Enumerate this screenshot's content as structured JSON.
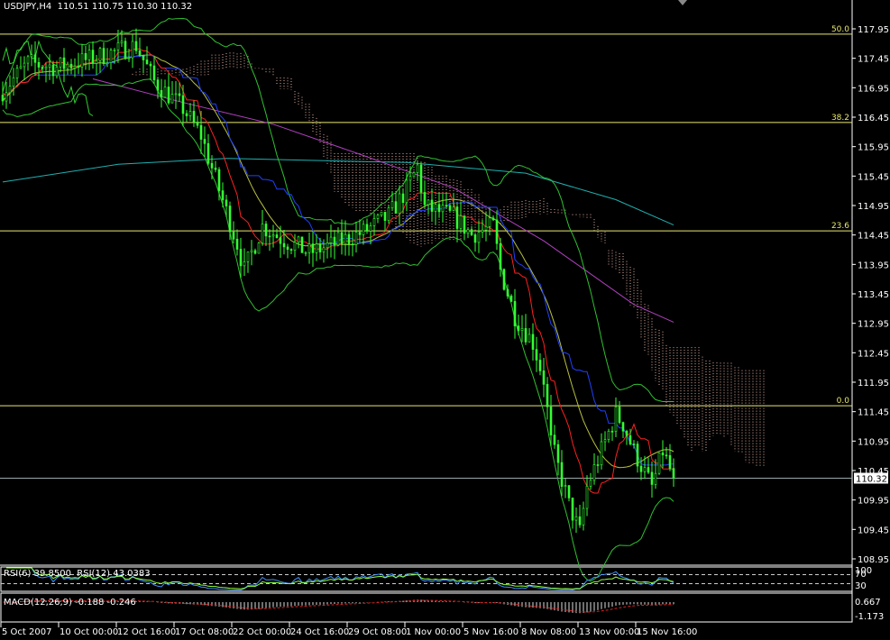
{
  "title": {
    "symbol": "USDJPY,H4",
    "ohlc": "110.51 110.75 110.30 110.32"
  },
  "chart_data": {
    "type": "candlestick",
    "symbol": "USDJPY",
    "timeframe": "H4",
    "ylim": [
      108.95,
      117.95
    ],
    "y_ticks": [
      "117.95",
      "117.45",
      "116.95",
      "116.45",
      "115.95",
      "115.45",
      "114.95",
      "114.45",
      "113.95",
      "113.45",
      "112.95",
      "112.45",
      "111.95",
      "111.45",
      "110.95",
      "110.45",
      "109.95",
      "109.45",
      "108.95"
    ],
    "x_ticks": [
      {
        "bar": 0,
        "label": "5 Oct 2007"
      },
      {
        "bar": 16,
        "label": "10 Oct 00:00"
      },
      {
        "bar": 32,
        "label": "12 Oct 16:00"
      },
      {
        "bar": 48,
        "label": "17 Oct 08:00"
      },
      {
        "bar": 64,
        "label": "22 Oct 00:00"
      },
      {
        "bar": 80,
        "label": "24 Oct 16:00"
      },
      {
        "bar": 96,
        "label": "29 Oct 08:00"
      },
      {
        "bar": 112,
        "label": "1 Nov 00:00"
      },
      {
        "bar": 128,
        "label": "5 Nov 16:00"
      },
      {
        "bar": 144,
        "label": "8 Nov 08:00"
      },
      {
        "bar": 160,
        "label": "13 Nov 00:00"
      },
      {
        "bar": 176,
        "label": "15 Nov 16:00"
      }
    ],
    "close_keypoints": [
      [
        0,
        116.9
      ],
      [
        7,
        117.37
      ],
      [
        15,
        117.3
      ],
      [
        25,
        117.45
      ],
      [
        37,
        117.67
      ],
      [
        42,
        117.06
      ],
      [
        50,
        116.6
      ],
      [
        55,
        116.14
      ],
      [
        60,
        115.22
      ],
      [
        65,
        114.3
      ],
      [
        67,
        113.85
      ],
      [
        72,
        114.6
      ],
      [
        77,
        114.4
      ],
      [
        85,
        114.15
      ],
      [
        92,
        114.3
      ],
      [
        100,
        114.5
      ],
      [
        107,
        114.77
      ],
      [
        112,
        115.22
      ],
      [
        115,
        115.6
      ],
      [
        117,
        114.92
      ],
      [
        125,
        114.77
      ],
      [
        130,
        114.46
      ],
      [
        136,
        114.6
      ],
      [
        138,
        113.85
      ],
      [
        142,
        113.08
      ],
      [
        147,
        112.62
      ],
      [
        150,
        112.0
      ],
      [
        152,
        110.94
      ],
      [
        157,
        109.87
      ],
      [
        160,
        109.4
      ],
      [
        162,
        110.17
      ],
      [
        167,
        110.94
      ],
      [
        170,
        111.4
      ],
      [
        172,
        111.24
      ],
      [
        175,
        110.78
      ],
      [
        180,
        110.17
      ],
      [
        183,
        110.78
      ],
      [
        186,
        110.32
      ]
    ],
    "ma_long_cyan": [
      [
        0,
        115.35
      ],
      [
        32,
        115.65
      ],
      [
        62,
        115.75
      ],
      [
        112,
        115.68
      ],
      [
        145,
        115.5
      ],
      [
        170,
        115.05
      ],
      [
        186,
        114.62
      ]
    ],
    "ma_magenta": [
      [
        25,
        117.1
      ],
      [
        50,
        116.7
      ],
      [
        75,
        116.33
      ],
      [
        100,
        115.8
      ],
      [
        125,
        115.25
      ],
      [
        150,
        114.35
      ],
      [
        175,
        113.27
      ],
      [
        186,
        112.97
      ]
    ],
    "fibonacci": [
      {
        "level": "50.0",
        "price": 117.86
      },
      {
        "level": "38.2",
        "price": 116.36
      },
      {
        "level": "23.6",
        "price": 114.52
      },
      {
        "level": "0.0",
        "price": 111.55
      }
    ],
    "current_price": "110.32",
    "rsi": {
      "label": "RSI(6) 39.8500  RSI(12) 43.0383",
      "scale": [
        "100",
        "70",
        "30"
      ]
    },
    "macd": {
      "label": "MACD(12,26,9) -0.188 -0.246",
      "scale": [
        "0.667",
        "-1.173"
      ]
    }
  },
  "colors": {
    "bg": "#000000",
    "candle": "#33ff33",
    "fib": "#e8e870",
    "cyan": "#20b0b0",
    "magenta": "#b040c0",
    "blue": "#2040ff",
    "red": "#ff2020",
    "band": "#30c030",
    "cloud": "#e0b0a0"
  }
}
